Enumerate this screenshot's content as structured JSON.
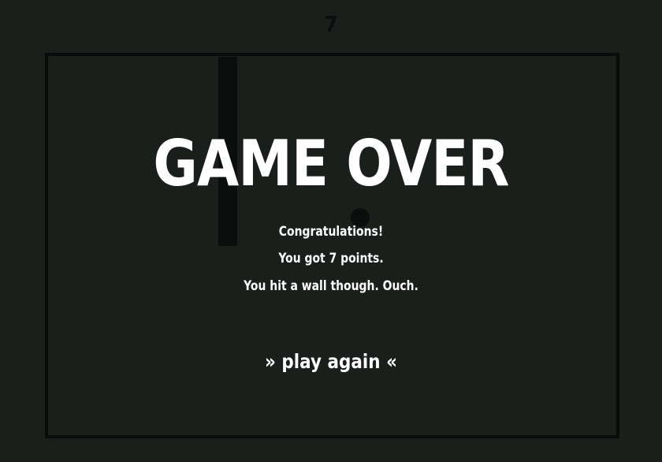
{
  "game": {
    "score": "7"
  },
  "overlay": {
    "title": "GAME OVER",
    "message_1": "Congratulations!",
    "message_2": "You got 7 points.",
    "message_3": "You hit a wall though. Ouch.",
    "play_again_label": "» play again «"
  },
  "colors": {
    "background": "#1b1f1c",
    "border": "#0a0c0b",
    "foreground": "#ffffff",
    "objects": "#0c0e0d"
  }
}
